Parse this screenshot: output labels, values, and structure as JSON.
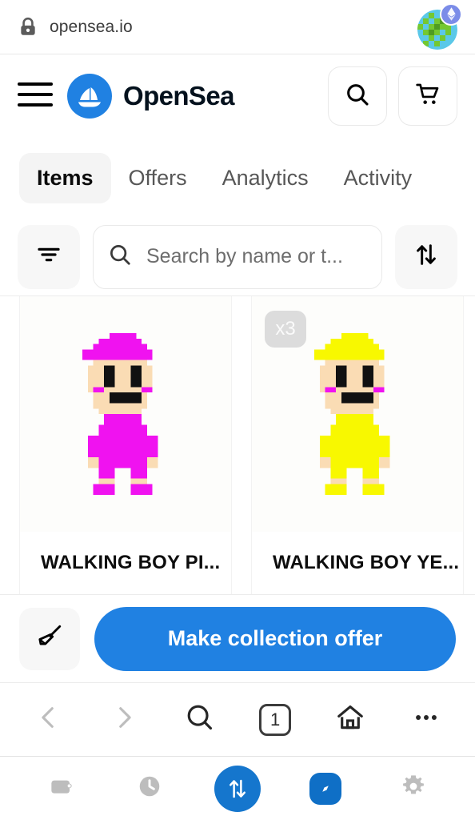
{
  "browser": {
    "url": "opensea.io",
    "lock_icon": "lock-icon",
    "avatar_icon": "globe-avatar",
    "eth_badge_icon": "ethereum-icon",
    "nav": {
      "back_label": "Back",
      "forward_label": "Forward",
      "search_label": "Search",
      "tab_count": "1",
      "home_label": "Home",
      "more_label": "More"
    }
  },
  "header": {
    "menu_label": "Menu",
    "brand": "OpenSea",
    "logo_icon": "opensea-sailboat-logo",
    "search_icon": "search-icon",
    "cart_icon": "shopping-cart-icon"
  },
  "tabs": [
    {
      "label": "Items",
      "active": true
    },
    {
      "label": "Offers",
      "active": false
    },
    {
      "label": "Analytics",
      "active": false
    },
    {
      "label": "Activity",
      "active": false
    }
  ],
  "filterbar": {
    "filter_icon": "filter-icon",
    "search_icon": "search-icon",
    "search_value": "",
    "search_placeholder": "Search by name or t...",
    "sort_icon": "sort-arrows-icon"
  },
  "items": [
    {
      "title": "WALKING BOY PI...",
      "badge": "",
      "art_name": "walking-boy-pink-pixel-art",
      "body_color": "#f012f0",
      "skin_color": "#fadcb4",
      "eye_color": "#111111",
      "cheek_color": "#f012f0",
      "background": "#fdfdfb"
    },
    {
      "title": "WALKING BOY YE...",
      "badge": "x3",
      "art_name": "walking-boy-yellow-pixel-art",
      "body_color": "#f8f800",
      "skin_color": "#fadcb4",
      "eye_color": "#111111",
      "cheek_color": "#f012f0",
      "background": "#fdfdfb"
    }
  ],
  "cta": {
    "sweep_icon": "broom-icon",
    "label": "Make collection offer"
  },
  "appbar": {
    "wallet_icon": "wallet-icon",
    "history_icon": "clock-icon",
    "swap_icon": "swap-arrows-icon",
    "browser_icon": "compass-icon",
    "settings_icon": "gear-icon"
  },
  "colors": {
    "accent": "#2081e2",
    "fab": "#1576cd",
    "tab_active_bg": "#f4f4f4",
    "chip_bg": "#f7f7f7",
    "badge_bg": "#dcdcdc"
  }
}
